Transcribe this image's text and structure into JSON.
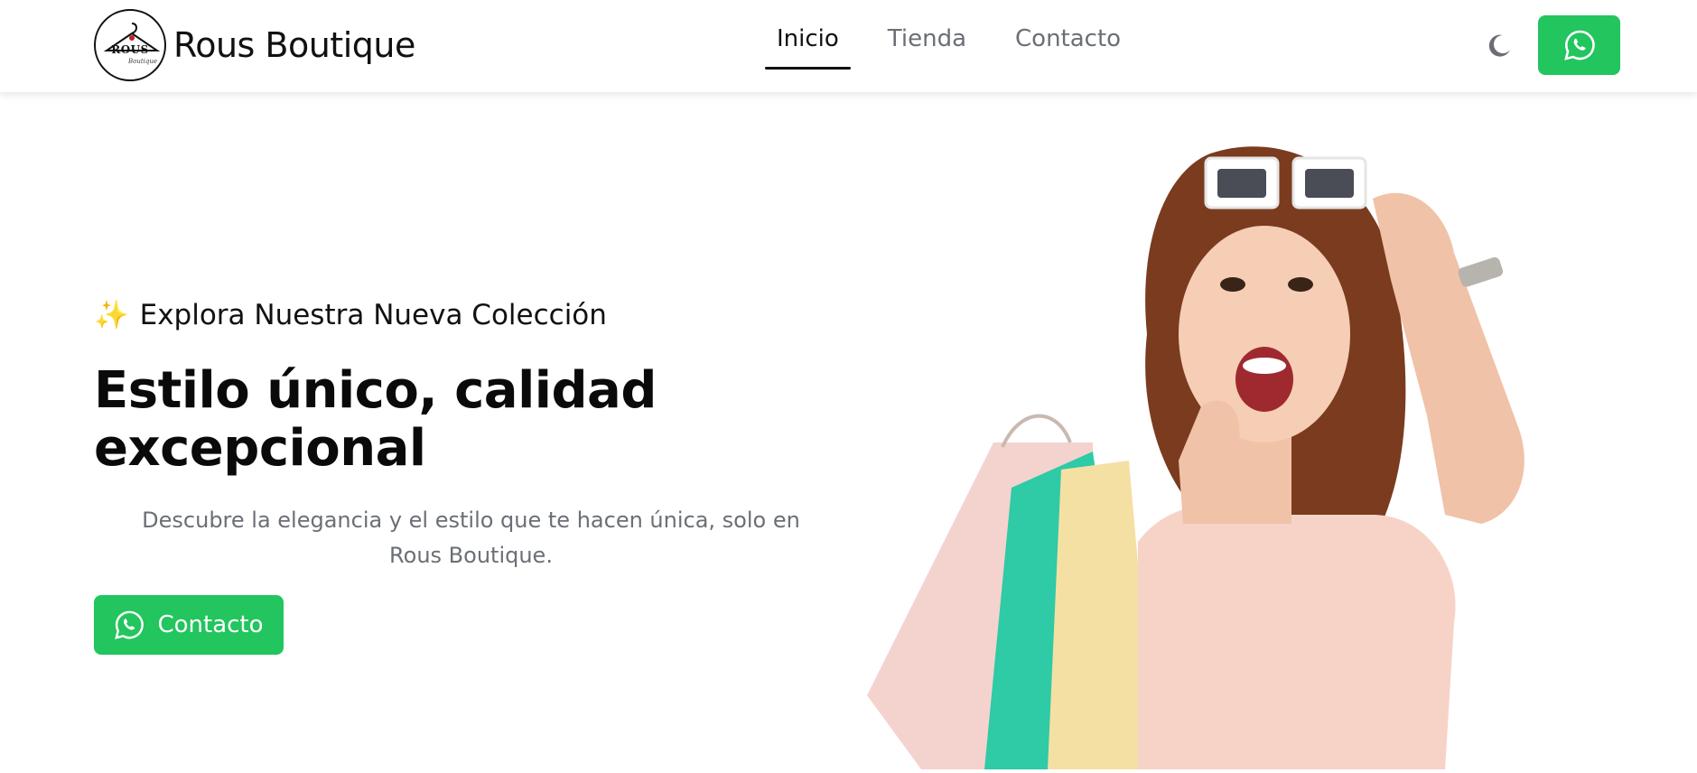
{
  "brand": {
    "name": "Rous Boutique",
    "logo_text": "ROUS",
    "logo_sub": "Boutique"
  },
  "nav": {
    "items": [
      {
        "label": "Inicio",
        "active": true
      },
      {
        "label": "Tienda",
        "active": false
      },
      {
        "label": "Contacto",
        "active": false
      }
    ]
  },
  "header_actions": {
    "theme_icon": "moon-icon",
    "whatsapp_icon": "whatsapp-icon"
  },
  "hero": {
    "eyebrow_emoji": "✨",
    "eyebrow": "Explora Nuestra Nueva Colección",
    "headline": "Estilo único, calidad excepcional",
    "lead": "Descubre la elegancia y el estilo que te hacen única, solo en Rous Boutique.",
    "cta_label": "Contacto"
  },
  "colors": {
    "accent_green": "#22c55e",
    "text_dark": "#111111",
    "text_muted": "#6b6f75"
  }
}
